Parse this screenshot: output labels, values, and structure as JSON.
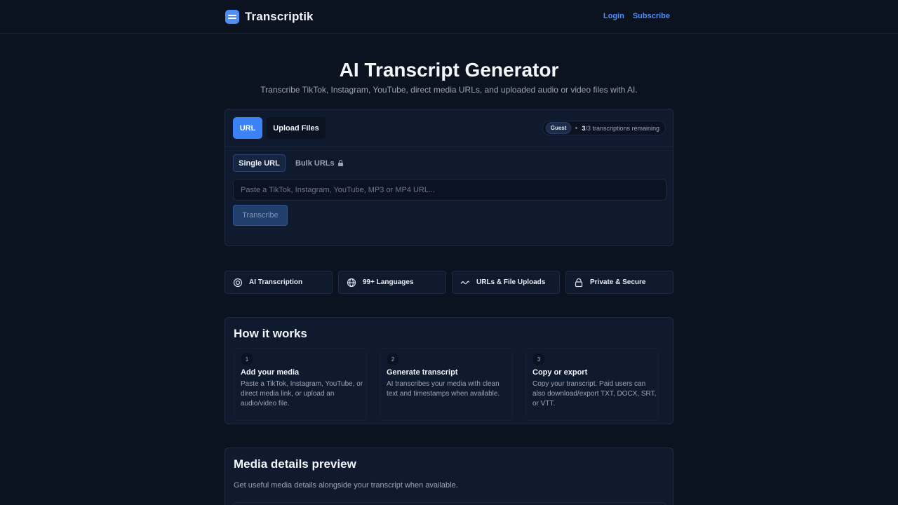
{
  "header": {
    "brand": "Transcriptik",
    "nav": {
      "login": "Login",
      "subscribe": "Subscribe"
    }
  },
  "hero": {
    "title": "AI Transcript Generator",
    "subtitle": "Transcribe TikTok, Instagram, YouTube, direct media URLs, and uploaded audio or video files with AI."
  },
  "transcriber": {
    "tabs": {
      "url": "URL",
      "upload": "Upload Files"
    },
    "quota": {
      "badge": "Guest",
      "used": "3",
      "rest": "/3 transcriptions remaining"
    },
    "modes": {
      "single": "Single URL",
      "bulk": "Bulk URLs"
    },
    "input": {
      "placeholder": "Paste a TikTok, Instagram, YouTube, MP3 or MP4 URL...",
      "value": ""
    },
    "submit": "Transcribe"
  },
  "features": [
    {
      "label": "AI Transcription",
      "icon": "target-icon"
    },
    {
      "label": "99+ Languages",
      "icon": "globe-icon"
    },
    {
      "label": "URLs & File Uploads",
      "icon": "waveform-icon"
    },
    {
      "label": "Private & Secure",
      "icon": "lock-icon"
    }
  ],
  "how_it_works": {
    "title": "How it works",
    "steps": [
      {
        "num": "1",
        "title": "Add your media",
        "desc": "Paste a TikTok, Instagram, YouTube, or direct media link, or upload an audio/video file."
      },
      {
        "num": "2",
        "title": "Generate transcript",
        "desc": "AI transcribes your media with clean text and timestamps when available."
      },
      {
        "num": "3",
        "title": "Copy or export",
        "desc": "Copy your transcript. Paid users can also download/export TXT, DOCX, SRT, or VTT."
      }
    ]
  },
  "media_preview": {
    "title": "Media details preview",
    "subtitle": "Get useful media details alongside your transcript when available."
  },
  "colors": {
    "accent": "#3b82f6",
    "background": "#0b1220",
    "card": "#0f1a2e"
  }
}
